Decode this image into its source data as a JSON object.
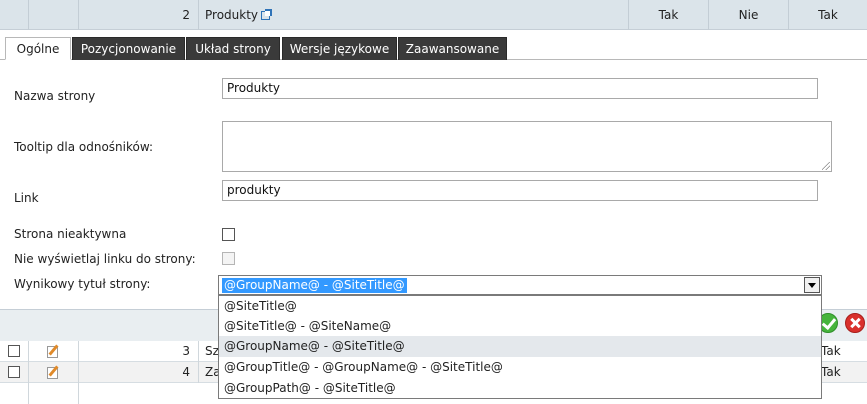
{
  "top_row": {
    "number": "2",
    "name": "Produkty",
    "col1": "Tak",
    "col2": "Nie",
    "col3": "Tak"
  },
  "tabs": [
    {
      "label": "Ogólne",
      "active": true
    },
    {
      "label": "Pozycjonowanie",
      "active": false
    },
    {
      "label": "Układ strony",
      "active": false
    },
    {
      "label": "Wersje językowe",
      "active": false
    },
    {
      "label": "Zaawansowane",
      "active": false
    }
  ],
  "form": {
    "page_name_label": "Nazwa strony",
    "page_name_value": "Produkty",
    "tooltip_label": "Tooltip dla odnośników:",
    "tooltip_value": "",
    "link_label": "Link",
    "link_value": "produkty",
    "inactive_label": "Strona nieaktywna",
    "inactive_checked": false,
    "hide_link_label": "Nie wyświetlaj linku do strony:",
    "hide_link_checked": false,
    "result_title_label": "Wynikowy tytuł strony:",
    "result_title_value": "@GroupName@ - @SiteTitle@"
  },
  "dropdown_options": [
    "@SiteTitle@",
    "@SiteTitle@ - @SiteName@",
    "@GroupName@ - @SiteTitle@",
    "@GroupTitle@ - @GroupName@ - @SiteTitle@",
    "@GroupPath@ - @SiteTitle@"
  ],
  "dropdown_hover_index": 2,
  "rows": [
    {
      "number": "3",
      "name_fragment": "Sz",
      "last": "Tak"
    },
    {
      "number": "4",
      "name_fragment": "Za",
      "last": "Tak"
    }
  ],
  "colors": {
    "tab_inactive": "#3a3a3a",
    "selection": "#3399ff",
    "ok": "#46b43c",
    "cancel": "#d9302c"
  },
  "icons": {
    "external_link": "external-link-icon",
    "ok": "checkmark-icon",
    "cancel": "close-icon",
    "edit": "edit-icon"
  }
}
